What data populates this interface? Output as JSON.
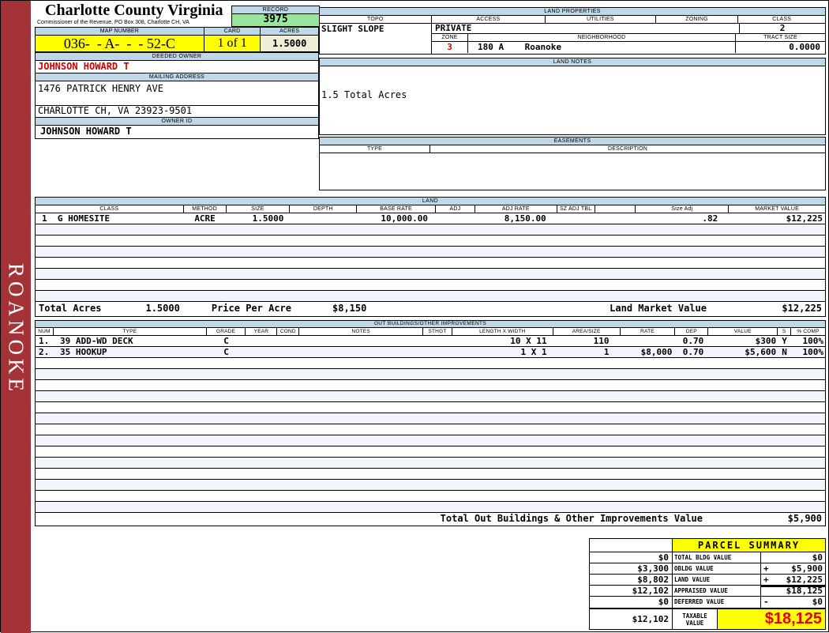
{
  "sidebar": {
    "district": "ROANOKE"
  },
  "header": {
    "title": "Charlotte County Virginia",
    "subtitle": "Commissioner of the Revenue, PO Box 308, Charlotte CH, VA",
    "record_label": "RECORD",
    "record_value": "3975",
    "map_label": "MAP NUMBER",
    "map_value": "036-  - A-  -  - 52-C",
    "card_label": "CARD",
    "card_value": "1 of 1",
    "acres_label": "ACRES",
    "acres_value": "1.5000"
  },
  "owner": {
    "deeded_owner_label": "DEEDED OWNER",
    "deeded_owner": "JOHNSON HOWARD T",
    "mailing_label": "MAILING ADDRESS",
    "address_line1": "1476 PATRICK HENRY AVE",
    "address_line2": "CHARLOTTE CH, VA 23923-9501",
    "owner_id_label": "OWNER ID",
    "owner_id": "JOHNSON HOWARD T"
  },
  "land_properties": {
    "title": "LAND PROPERTIES",
    "topo_label": "TOPO",
    "access_label": "ACCESS",
    "utilities_label": "UTILITIES",
    "zoning_label": "ZONING",
    "class_label": "CLASS",
    "topo": "SLIGHT SLOPE",
    "access": "PRIVATE",
    "class": "2",
    "zone_label": "ZONE",
    "neighborhood_label": "NEIGHBORHOOD",
    "tract_label": "TRACT SIZE",
    "zone": "3",
    "neighborhood": "180 A    Roanoke",
    "tract_size": "0.0000"
  },
  "land_notes": {
    "title": "LAND NOTES",
    "note": "1.5 Total Acres"
  },
  "easements": {
    "title": "EASEMENTS",
    "type_label": "TYPE",
    "desc_label": "DESCRIPTION"
  },
  "land": {
    "title": "LAND",
    "columns": [
      "CLASS",
      "METHOD",
      "SIZE",
      "DEPTH",
      "BASE RATE",
      "ADJ",
      "ADJ RATE",
      "SZ ADJ TBL",
      "",
      "Size Adj",
      "MARKET VALUE"
    ],
    "row": {
      "class": "1  G HOMESITE",
      "method": "ACRE",
      "size": "1.5000",
      "depth": "",
      "base_rate": "10,000.00",
      "adj": "",
      "adj_rate": "8,150.00",
      "sz_adj_tbl": "",
      "blank": "",
      "size_adj": ".82",
      "market_value": "$12,225"
    },
    "totals": {
      "total_acres_label": "Total Acres",
      "total_acres": "1.5000",
      "price_per_acre_label": "Price Per Acre",
      "price_per_acre": "$8,150",
      "market_label": "Land Market Value",
      "market_value": "$12,225"
    }
  },
  "outbuildings": {
    "title": "OUT BUILDINGS/OTHER IMPROVEMENTS",
    "columns": [
      "NUM",
      "TYPE",
      "GRADE",
      "YEAR",
      "COND",
      "NOTES",
      "STHGT",
      "LENGTH X WIDTH",
      "AREA/SIZE",
      "RATE",
      "DEP",
      "VALUE",
      "S",
      "% COMP"
    ],
    "rows": [
      {
        "num": "1.",
        "type": "39 ADD-WD DECK",
        "grade": "C",
        "year": "",
        "cond": "",
        "notes": "",
        "sthgt": "",
        "lw": "10 X 11",
        "area": "110",
        "rate": "",
        "dep": "0.70",
        "value": "$300",
        "s": "Y",
        "comp": "100%"
      },
      {
        "num": "2.",
        "type": "35 HOOKUP",
        "grade": "C",
        "year": "",
        "cond": "",
        "notes": "",
        "sthgt": "",
        "lw": "1 X 1",
        "area": "1",
        "rate": "$8,000",
        "dep": "0.70",
        "value": "$5,600",
        "s": "N",
        "comp": "100%"
      }
    ],
    "total_label": "Total Out Buildings & Other Improvements Value",
    "total_value": "$5,900"
  },
  "parcel_summary": {
    "title": "PARCEL SUMMARY",
    "rows": [
      {
        "prev": "$0",
        "label": "TOTAL BLDG VALUE",
        "op": "",
        "value": "$0"
      },
      {
        "prev": "$3,300",
        "label": "OBLDG VALUE",
        "op": "+",
        "value": "$5,900"
      },
      {
        "prev": "$8,802",
        "label": "LAND VALUE",
        "op": "+",
        "value": "$12,225"
      },
      {
        "prev": "$12,102",
        "label": "APPRAISED VALUE",
        "op": "",
        "value": "$18,125"
      },
      {
        "prev": "$0",
        "label": "DEFERRED VALUE",
        "op": "-",
        "value": "$0"
      }
    ],
    "taxable": {
      "prev": "$12,102",
      "label": "TAXABLE VALUE",
      "value": "$18,125"
    }
  },
  "colors": {
    "header_bar_blue": "#BFD8E8",
    "record_green": "#9BE49B",
    "highlight_yellow": "#FFFF00",
    "acres_cream": "#F0EDD6",
    "stripe_blue": "#F1F4FB",
    "alert_red": "#CC0000",
    "taxable_red": "#E00000",
    "sidebar_red": "#A43338"
  }
}
